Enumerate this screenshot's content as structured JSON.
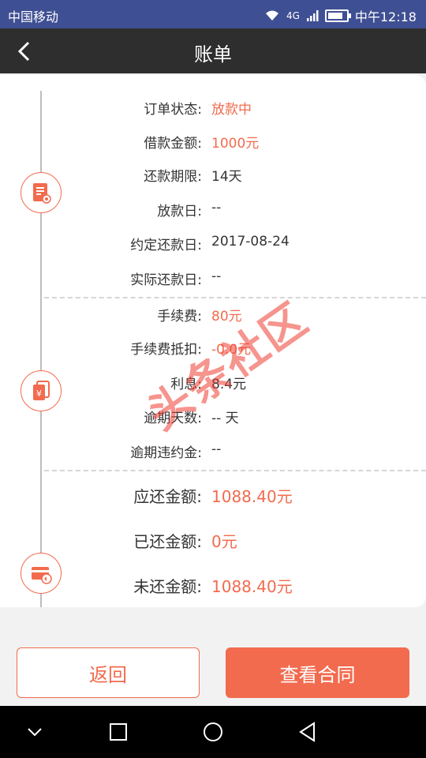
{
  "status_bar": {
    "carrier": "中国移动",
    "network": "4G",
    "time": "中午12:18"
  },
  "header": {
    "title": "账单"
  },
  "sections": [
    {
      "icon": "document-icon",
      "rows": [
        {
          "label": "订单状态:",
          "value": "放款中",
          "highlight": true
        },
        {
          "label": "借款金额:",
          "value": "1000元",
          "highlight": true
        },
        {
          "label": "还款期限:",
          "value": "14天",
          "highlight": false
        },
        {
          "label": "放款日:",
          "value": "--",
          "highlight": false
        },
        {
          "label": "约定还款日:",
          "value": "2017-08-24",
          "highlight": false
        },
        {
          "label": "实际还款日:",
          "value": "--",
          "highlight": false
        }
      ]
    },
    {
      "icon": "yen-document-icon",
      "rows": [
        {
          "label": "手续费:",
          "value": "80元",
          "highlight": true
        },
        {
          "label": "手续费抵扣:",
          "value": "-0.0元",
          "highlight": true
        },
        {
          "label": "利息:",
          "value": "8.4元",
          "highlight": false
        },
        {
          "label": "逾期天数:",
          "value": "-- 天",
          "highlight": false
        },
        {
          "label": "逾期违约金:",
          "value": "--",
          "highlight": false
        }
      ]
    },
    {
      "icon": "card-refund-icon",
      "rows": [
        {
          "label": "应还金额:",
          "value": "1088.40元",
          "highlight": true
        },
        {
          "label": "已还金额:",
          "value": "0元",
          "highlight": true
        },
        {
          "label": "未还金额:",
          "value": "1088.40元",
          "highlight": true
        }
      ]
    }
  ],
  "watermark": "头条社区",
  "buttons": {
    "back": "返回",
    "contract": "查看合同"
  },
  "colors": {
    "accent": "#f26b4e",
    "status_bar": "#3f4f93",
    "title_bar": "#2e2e2e"
  }
}
